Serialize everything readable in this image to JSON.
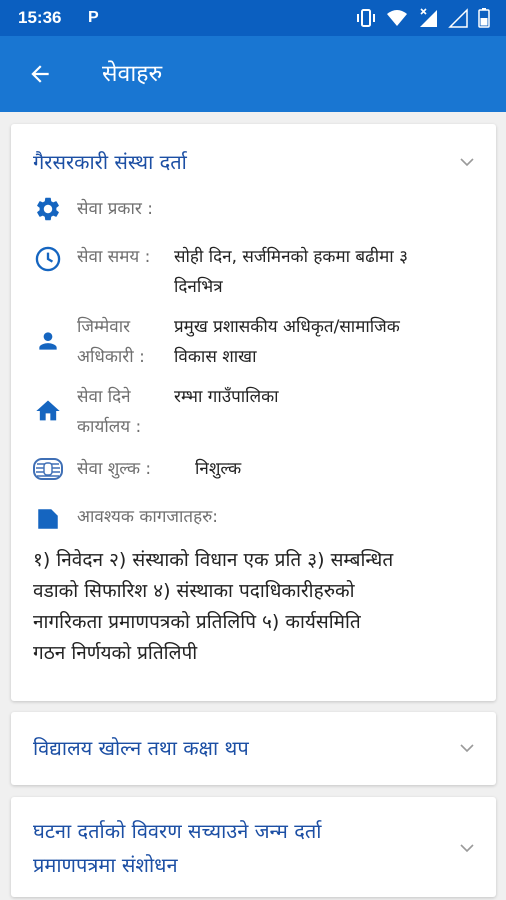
{
  "status_bar": {
    "time": "15:36",
    "app_indicator": "P",
    "icons": [
      "vibrate-icon",
      "wifi-icon",
      "signal-off-icon",
      "signal-icon",
      "battery-icon"
    ]
  },
  "app_bar": {
    "title": "सेवाहरु",
    "back_icon": "arrow-back-icon"
  },
  "services": [
    {
      "title": "गैरसरकारी संस्था दर्ता",
      "expanded": true,
      "details": {
        "type": {
          "label": "सेवा प्रकार :",
          "value": "",
          "icon": "gear-icon"
        },
        "time": {
          "label": "सेवा समय :",
          "value_line1": "सोही दिन,  सर्जमिनको हकमा बढीमा ३",
          "value_line2": "दिनभित्र",
          "icon": "clock-icon"
        },
        "officer": {
          "label_line1": "जिम्मेवार",
          "label_line2": "अधिकारी :",
          "value_line1": "प्रमुख प्रशासकीय अधिकृत/सामाजिक",
          "value_line2": "विकास शाखा",
          "icon": "person-icon"
        },
        "office": {
          "label_line1": "सेवा दिने",
          "label_line2": "कार्यालय :",
          "value": "रम्भा गाउँपालिका",
          "icon": "home-icon"
        },
        "fee": {
          "label": "सेवा शुल्क :",
          "value": "निशुल्क",
          "icon": "fee-icon"
        },
        "documents": {
          "label": "आवश्यक कागजातहरु:",
          "icon": "file-icon",
          "lines": [
            "१) निवेदन २) संस्थाको विधान एक प्रति ३) सम्बन्धित",
            "वडाको सिफारिश ४) संस्थाका पदाधिकारीहरुको",
            "नागरिकता प्रमाणपत्रको प्रतिलिपि ५) कार्यसमिति",
            "गठन निर्णयको प्रतिलिपी"
          ]
        }
      }
    },
    {
      "title": "विद्यालय खोल्न तथा कक्षा थप",
      "expanded": false
    },
    {
      "title_line1": "घटना दर्ताको विवरण सच्याउने जन्म दर्ता",
      "title_line2": "प्रमाणपत्रमा संशोधन",
      "expanded": false
    }
  ],
  "colors": {
    "status_bar": "#0b5fc0",
    "app_bar": "#1976d2",
    "icon_blue": "#1565c0",
    "title_blue": "#1c4fa4",
    "label_grey": "#6f6f6f",
    "background": "#f0f0f0"
  }
}
